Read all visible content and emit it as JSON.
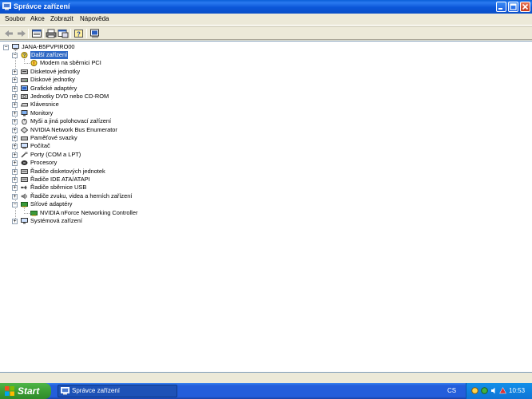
{
  "window": {
    "title": "Správce zařízení"
  },
  "menu": {
    "items": [
      "Soubor",
      "Akce",
      "Zobrazit",
      "Nápověda"
    ]
  },
  "toolbar": {
    "buttons": [
      "back-icon",
      "forward-icon",
      "properties-icon",
      "print-icon",
      "refresh-icon",
      "help-icon",
      "scan-hardware-icon"
    ]
  },
  "tree": {
    "root": "JANA-B5PVPIRO00",
    "nodes": [
      {
        "label": "Další zařízení",
        "icon": "other-devices-icon",
        "expanded": true,
        "selected": true
      },
      {
        "label": "Modem na sběrnici PCI",
        "icon": "unknown-device-warning-icon",
        "child": true
      },
      {
        "label": "Disketové jednotky",
        "icon": "floppy-drive-icon"
      },
      {
        "label": "Diskové jednotky",
        "icon": "disk-drive-icon"
      },
      {
        "label": "Grafické adaptéry",
        "icon": "display-adapter-icon"
      },
      {
        "label": "Jednotky DVD nebo CD-ROM",
        "icon": "dvd-drive-icon"
      },
      {
        "label": "Klávesnice",
        "icon": "keyboard-icon"
      },
      {
        "label": "Monitory",
        "icon": "monitor-icon"
      },
      {
        "label": "Myši a jiná polohovací zařízení",
        "icon": "mouse-icon"
      },
      {
        "label": "NVIDIA Network Bus Enumerator",
        "icon": "network-bus-icon"
      },
      {
        "label": "Paměťové svazky",
        "icon": "storage-volume-icon"
      },
      {
        "label": "Počítač",
        "icon": "computer-icon"
      },
      {
        "label": "Porty (COM a LPT)",
        "icon": "port-icon"
      },
      {
        "label": "Procesory",
        "icon": "processor-icon"
      },
      {
        "label": "Řadiče disketových jednotek",
        "icon": "floppy-controller-icon"
      },
      {
        "label": "Řadiče IDE ATA/ATAPI",
        "icon": "ide-controller-icon"
      },
      {
        "label": "Řadiče sběrnice USB",
        "icon": "usb-icon"
      },
      {
        "label": "Řadiče zvuku, videa a herních zařízení",
        "icon": "sound-icon"
      },
      {
        "label": "Síťové adaptéry",
        "icon": "network-adapter-icon",
        "expanded": true
      },
      {
        "label": "NVIDIA nForce Networking Controller",
        "icon": "network-card-icon",
        "child": true
      },
      {
        "label": "Systémová zařízení",
        "icon": "system-device-icon"
      }
    ]
  },
  "taskbar": {
    "start_label": "Start",
    "task_label": "Správce zařízení",
    "language": "CS",
    "clock": "10:53"
  },
  "colors": {
    "titlebar": "#0b56d8",
    "selection": "#316ac5",
    "taskbar": "#245edb",
    "start": "#3c9e34"
  }
}
